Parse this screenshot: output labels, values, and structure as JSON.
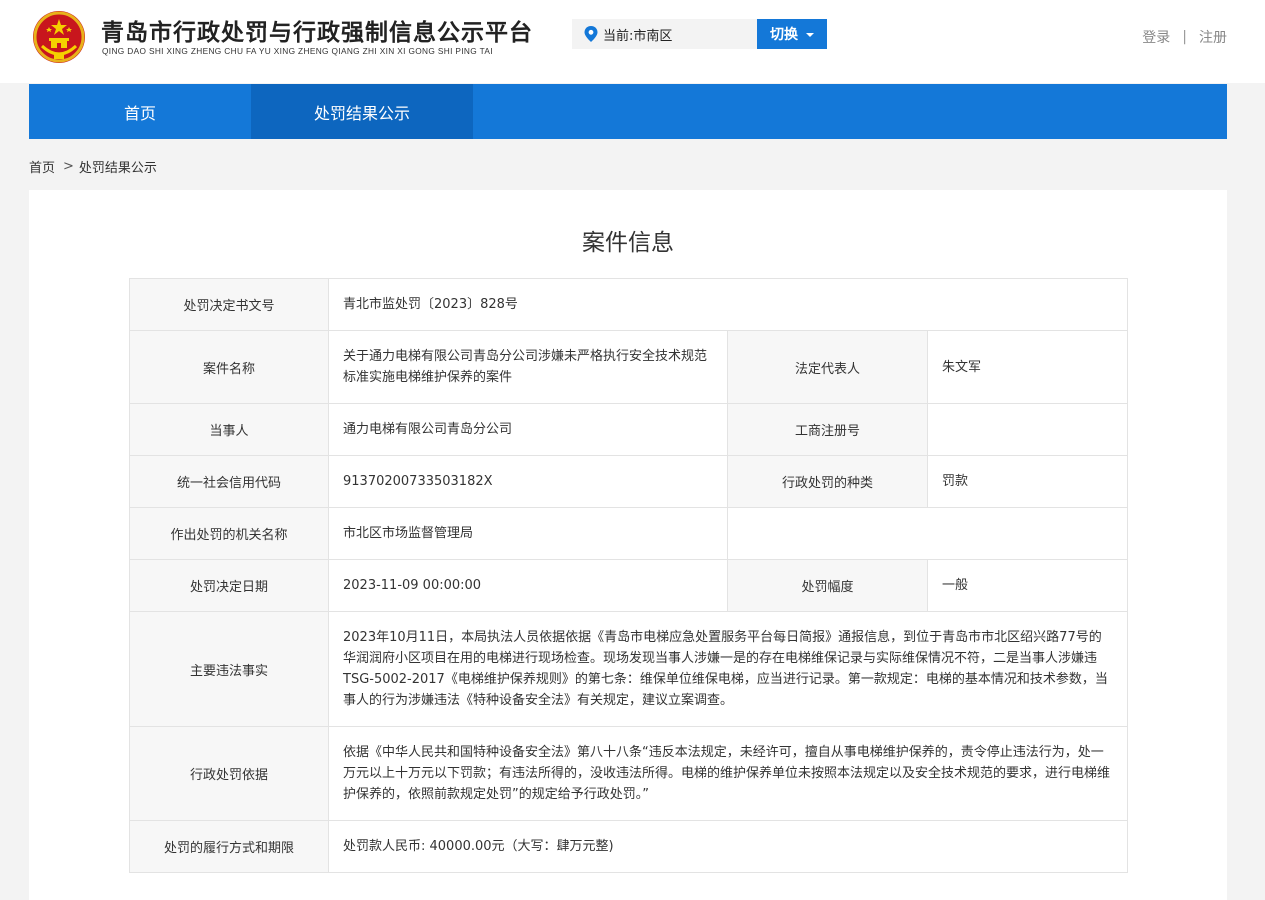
{
  "header": {
    "title_cn": "青岛市行政处罚与行政强制信息公示平台",
    "title_en": "QING DAO SHI XING ZHENG CHU FA YU XING ZHENG QIANG ZHI XIN XI GONG SHI PING TAI",
    "emblem_icon": "national-emblem-icon",
    "location_label": "当前:市南区",
    "switch_label": "切换",
    "login": "登录",
    "separator": "|",
    "register": "注册"
  },
  "nav": {
    "items": [
      {
        "label": "首页",
        "active": false
      },
      {
        "label": "处罚结果公示",
        "active": true
      }
    ]
  },
  "breadcrumb": {
    "home": "首页",
    "sep": ">",
    "current": "处罚结果公示"
  },
  "page_title": "案件信息",
  "case": {
    "doc_no_label": "处罚决定书文号",
    "doc_no": "青北市监处罚〔2023〕828号",
    "case_name_label": "案件名称",
    "case_name": "关于通力电梯有限公司青岛分公司涉嫌未严格执行安全技术规范标准实施电梯维护保养的案件",
    "legal_rep_label": "法定代表人",
    "legal_rep": "朱文军",
    "party_label": "当事人",
    "party": "通力电梯有限公司青岛分公司",
    "biz_reg_label": "工商注册号",
    "biz_reg": "",
    "credit_code_label": "统一社会信用代码",
    "credit_code": "91370200733503182X",
    "penalty_type_label": "行政处罚的种类",
    "penalty_type": "罚款",
    "authority_label": "作出处罚的机关名称",
    "authority": "市北区市场监督管理局",
    "date_label": "处罚决定日期",
    "date": "2023-11-09 00:00:00",
    "range_label": "处罚幅度",
    "range": "一般",
    "violation_label": "主要违法事实",
    "violation": "2023年10月11日，本局执法人员依据依据《青岛市电梯应急处置服务平台每日简报》通报信息，到位于青岛市市北区绍兴路77号的华润润府小区项目在用的电梯进行现场检查。现场发现当事人涉嫌一是的存在电梯维保记录与实际维保情况不符，二是当事人涉嫌违TSG-5002-2017《电梯维护保养规则》的第七条：维保单位维保电梯，应当进行记录。第一款规定：电梯的基本情况和技术参数，当事人的行为涉嫌违法《特种设备安全法》有关规定，建议立案调查。",
    "basis_label": "行政处罚依据",
    "basis": "依据《中华人民共和国特种设备安全法》第八十八条“违反本法规定，未经许可，擅自从事电梯维护保养的，责令停止违法行为，处一万元以上十万元以下罚款；有违法所得的，没收违法所得。电梯的维护保养单位未按照本法规定以及安全技术规范的要求，进行电梯维护保养的，依照前款规定处罚”的规定给予行政处罚。”",
    "fulfill_label": "处罚的履行方式和期限",
    "fulfill": "处罚款人民币: 40000.00元（大写：肆万元整)"
  },
  "colors": {
    "nav_blue": "#1478d8",
    "nav_active": "#0d66bf",
    "label_bg": "#f7f7f7",
    "border": "#e3e3e3"
  }
}
